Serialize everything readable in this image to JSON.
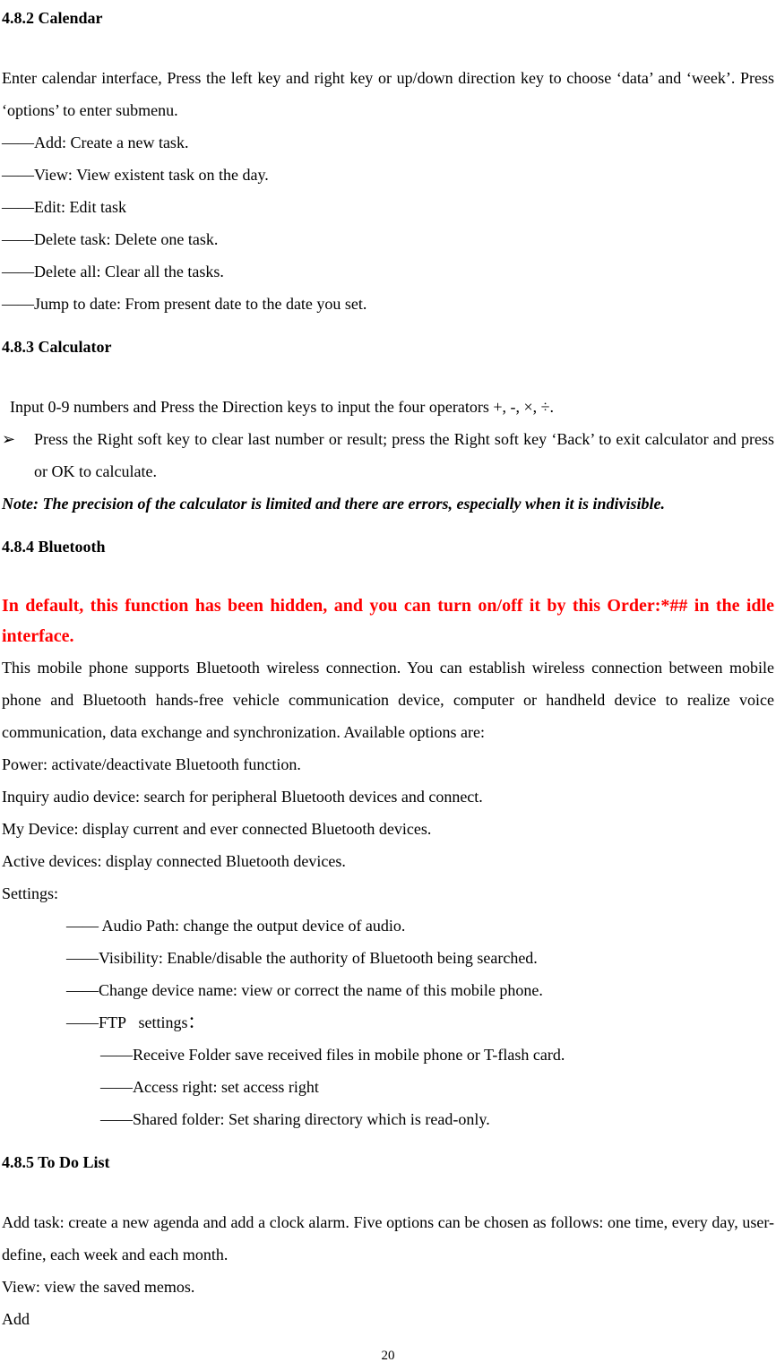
{
  "h_482": "4.8.2 Calendar",
  "p_482_intro": "Enter calendar interface, Press the left key and right key or up/down direction key to choose ‘data’ and ‘week’. Press ‘options’ to enter submenu.",
  "l_add": "——Add: Create a new task.",
  "l_view": "——View: View existent task on the day.",
  "l_edit": "——Edit: Edit task",
  "l_delete_task": "——Delete task: Delete one task.",
  "l_delete_all": "——Delete all: Clear all the tasks.",
  "l_jump": "——Jump to date: From present date to the date you set.",
  "h_483": "4.8.3 Calculator",
  "p_483_1": "  Input 0-9 numbers and Press the Direction keys to input the four operators +, -, ×, ÷.",
  "bullet_mark": "➢",
  "p_483_2": "Press the Right soft key to clear last number or result; press the Right soft key ‘Back’ to exit calculator and press or OK to calculate.",
  "note_483": "Note: The precision of the calculator is limited and there are errors, especially when it is indivisible.",
  "h_484": "4.8.4 Bluetooth",
  "red_484": "In default, this function has been hidden, and you can turn on/off it by this Order:*## in the idle interface.",
  "p_484_intro": "This mobile phone supports Bluetooth wireless connection. You can establish wireless connection between mobile phone and Bluetooth hands-free vehicle communication device, computer or handheld device to realize voice communication, data exchange and synchronization. Available options are:",
  "l_power": "Power: activate/deactivate Bluetooth function.",
  "l_inquiry": "Inquiry audio device: search for peripheral Bluetooth devices and connect.",
  "l_mydevice": "My Device: display current and ever connected Bluetooth devices.",
  "l_active": "Active devices: display connected Bluetooth devices.",
  "l_settings": "Settings:",
  "l_audio_path": "—— Audio Path: change the output device of audio.",
  "l_visibility": "——Visibility: Enable/disable the authority of Bluetooth being searched.",
  "l_change_name": "——Change device name: view or correct the name of this mobile phone.",
  "l_ftp": "——FTP   settings：",
  "l_receive_folder": "——Receive Folder save received files in mobile phone or T-flash card.",
  "l_access_right": "——Access right: set access right",
  "l_shared_folder": "——Shared folder: Set sharing directory which is read-only.",
  "h_485": "4.8.5 To Do List",
  "p_485_addtask": "Add task: create a new agenda and add a clock alarm. Five options can be chosen as follows: one time, every day, user-define, each week and each month.",
  "l_485_view": "View: view the saved memos.",
  "l_485_add": "Add",
  "page_number": "20"
}
